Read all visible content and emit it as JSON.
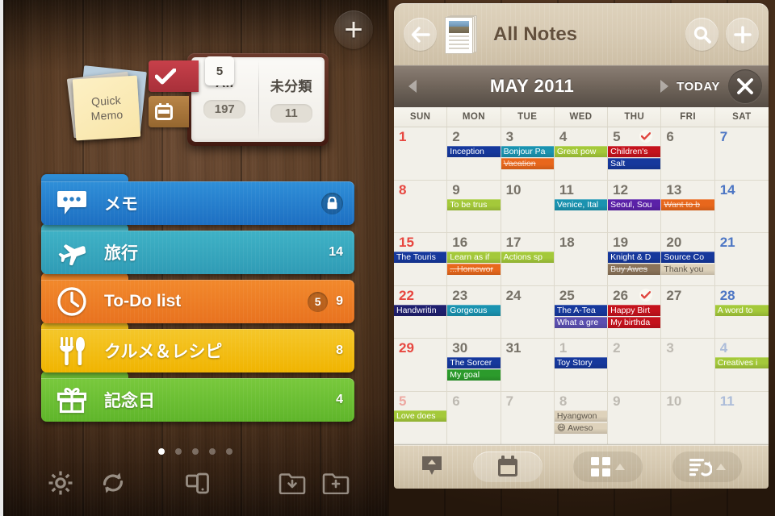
{
  "left": {
    "add_button_icon": "plus-icon",
    "quick_memo": {
      "line1": "Quick",
      "line2": "Memo"
    },
    "notebook": {
      "check_tab_icon": "check-icon",
      "calendar_tab_icon": "calendar-icon",
      "check_badge": "5",
      "pages": [
        {
          "title": "All",
          "count": "197"
        },
        {
          "title": "未分類",
          "count": "11"
        }
      ]
    },
    "folders": [
      {
        "name": "メモ",
        "icon": "speech-bubble-icon",
        "count": "",
        "badge": "",
        "locked": true,
        "color": "#1d6fc2",
        "color2": "#2f8fd8",
        "tab": "#2a86cf"
      },
      {
        "name": "旅行",
        "icon": "airplane-icon",
        "count": "14",
        "badge": "",
        "locked": false,
        "color": "#2f9bb5",
        "color2": "#3fb2c6",
        "tab": "#44b0c2"
      },
      {
        "name": "To-Do list",
        "icon": "clock-icon",
        "count": "9",
        "badge": "5",
        "locked": false,
        "color": "#e8721f",
        "color2": "#f2892c",
        "tab": "#ef8526"
      },
      {
        "name": "クルメ＆レシピ",
        "icon": "cutlery-icon",
        "count": "8",
        "badge": "",
        "locked": false,
        "color": "#f0b400",
        "color2": "#f5c72b",
        "tab": "#f2bc0c"
      },
      {
        "name": "記念日",
        "icon": "gift-icon",
        "count": "4",
        "badge": "",
        "locked": false,
        "color": "#5fb52a",
        "color2": "#79c93d",
        "tab": "#6cc033"
      }
    ],
    "page_dots": {
      "count": 5,
      "active_index": 0
    },
    "toolbar": [
      {
        "icon": "gear-icon",
        "label": "Settings"
      },
      {
        "icon": "sync-icon",
        "label": "Sync"
      },
      {
        "icon": "devices-icon",
        "label": "Devices"
      },
      {
        "icon": "folder-down-icon",
        "label": "Import to folder"
      },
      {
        "icon": "folder-plus-icon",
        "label": "New folder"
      }
    ]
  },
  "right": {
    "header": {
      "back_icon": "back-arrow-icon",
      "thumb_icon": "note-thumbnail-icon",
      "title": "All Notes",
      "search_icon": "search-icon",
      "add_icon": "plus-icon"
    },
    "month_bar": {
      "prev_icon": "triangle-left-icon",
      "month_label": "MAY 2011",
      "next_icon": "triangle-right-icon",
      "today_label": "TODAY",
      "close_icon": "close-icon"
    },
    "calendar": {
      "day_headers": [
        "SUN",
        "MON",
        "TUE",
        "WED",
        "THU",
        "FRI",
        "SAT"
      ],
      "weeks": [
        [
          {
            "day": "1",
            "kind": "sun",
            "events": []
          },
          {
            "day": "2",
            "kind": "day",
            "events": [
              {
                "text": "Inception",
                "color": "#16389c"
              }
            ]
          },
          {
            "day": "3",
            "kind": "day",
            "events": [
              {
                "text": "Bonjour Pa",
                "color": "#1b93b0"
              },
              {
                "text": "Vacation",
                "color": "#e8671c",
                "done": true
              }
            ]
          },
          {
            "day": "4",
            "kind": "day",
            "events": [
              {
                "text": "Great pow",
                "color": "#a4c93a"
              }
            ]
          },
          {
            "day": "5",
            "kind": "day",
            "checked": true,
            "events": [
              {
                "text": "Children's",
                "color": "#c4121c"
              },
              {
                "text": "Salt",
                "color": "#16389c"
              }
            ]
          },
          {
            "day": "6",
            "kind": "day",
            "events": []
          },
          {
            "day": "7",
            "kind": "sat",
            "events": []
          }
        ],
        [
          {
            "day": "8",
            "kind": "sun",
            "events": []
          },
          {
            "day": "9",
            "kind": "day",
            "events": [
              {
                "text": "To be trus",
                "color": "#a4c93a"
              }
            ]
          },
          {
            "day": "10",
            "kind": "day",
            "events": []
          },
          {
            "day": "11",
            "kind": "day",
            "events": [
              {
                "text": "Venice, Ital",
                "color": "#1b93b0"
              }
            ]
          },
          {
            "day": "12",
            "kind": "day",
            "events": [
              {
                "text": "Seoul, Sou",
                "color": "#5b21a8"
              }
            ]
          },
          {
            "day": "13",
            "kind": "day",
            "events": [
              {
                "text": "Want to b",
                "color": "#e8671c",
                "done": true
              }
            ]
          },
          {
            "day": "14",
            "kind": "sat",
            "events": []
          }
        ],
        [
          {
            "day": "15",
            "kind": "sun",
            "events": [
              {
                "text": "The Touris",
                "color": "#16389c"
              }
            ]
          },
          {
            "day": "16",
            "kind": "day",
            "events": [
              {
                "text": "Learn as if",
                "color": "#a4c93a"
              },
              {
                "text": "...Homewor",
                "color": "#e8671c",
                "done": true
              }
            ]
          },
          {
            "day": "17",
            "kind": "day",
            "events": [
              {
                "text": "Actions sp",
                "color": "#a4c93a"
              }
            ]
          },
          {
            "day": "18",
            "kind": "day",
            "events": []
          },
          {
            "day": "19",
            "kind": "day",
            "events": [
              {
                "text": "Knight & D",
                "color": "#16389c"
              },
              {
                "text": "Buy Awes",
                "color": "#8a7359",
                "done": true
              }
            ]
          },
          {
            "day": "20",
            "kind": "day",
            "events": [
              {
                "text": "Source Co",
                "color": "#16389c"
              },
              {
                "text": "Thank you",
                "color": "#ded2bb",
                "dark": true
              }
            ]
          },
          {
            "day": "21",
            "kind": "sat",
            "events": []
          }
        ],
        [
          {
            "day": "22",
            "kind": "sun",
            "events": [
              {
                "text": "Handwritin",
                "color": "#1f1f6e"
              }
            ]
          },
          {
            "day": "23",
            "kind": "day",
            "events": [
              {
                "text": "Gorgeous",
                "color": "#1b93b0"
              }
            ]
          },
          {
            "day": "24",
            "kind": "day",
            "events": []
          },
          {
            "day": "25",
            "kind": "day",
            "events": [
              {
                "text": "The A-Tea",
                "color": "#16389c"
              },
              {
                "text": "What a gre",
                "color": "#5b4fb0"
              }
            ]
          },
          {
            "day": "26",
            "kind": "day",
            "checked": true,
            "events": [
              {
                "text": "Happy Birt",
                "color": "#c4121c"
              },
              {
                "text": "My birthda",
                "color": "#c4121c"
              }
            ]
          },
          {
            "day": "27",
            "kind": "day",
            "events": []
          },
          {
            "day": "28",
            "kind": "sat",
            "events": [
              {
                "text": "A word to",
                "color": "#a4c93a"
              }
            ]
          }
        ],
        [
          {
            "day": "29",
            "kind": "sun",
            "events": []
          },
          {
            "day": "30",
            "kind": "day",
            "events": [
              {
                "text": "The Sorcer",
                "color": "#16389c"
              },
              {
                "text": "My goal",
                "color": "#2c9b2c"
              }
            ]
          },
          {
            "day": "31",
            "kind": "day",
            "events": []
          },
          {
            "day": "1",
            "kind": "out",
            "events": [
              {
                "text": "Toy Story",
                "color": "#16389c"
              }
            ]
          },
          {
            "day": "2",
            "kind": "out",
            "events": []
          },
          {
            "day": "3",
            "kind": "out",
            "events": []
          },
          {
            "day": "4",
            "kind": "out-sat",
            "events": [
              {
                "text": "Creatives i",
                "color": "#a4c93a"
              }
            ]
          }
        ],
        [
          {
            "day": "5",
            "kind": "out-sun",
            "events": [
              {
                "text": "Love does",
                "color": "#a4c93a"
              }
            ]
          },
          {
            "day": "6",
            "kind": "out",
            "events": []
          },
          {
            "day": "7",
            "kind": "out",
            "events": []
          },
          {
            "day": "8",
            "kind": "out",
            "events": [
              {
                "text": "Hyangwon",
                "color": "#ded2bb",
                "dark": true
              },
              {
                "text": "😄 Aweso",
                "color": "#ded2bb",
                "dark": true
              }
            ]
          },
          {
            "day": "9",
            "kind": "out",
            "events": []
          },
          {
            "day": "10",
            "kind": "out",
            "events": []
          },
          {
            "day": "11",
            "kind": "out-sat",
            "events": []
          }
        ]
      ]
    },
    "toolbar": [
      {
        "icon": "export-icon",
        "label": "Export",
        "style": "plain"
      },
      {
        "icon": "calendar-icon",
        "label": "Calendar",
        "style": "pill"
      },
      {
        "icon": "grid-view-icon",
        "label": "Grid",
        "style": "dim",
        "caret": true
      },
      {
        "icon": "sort-list-icon",
        "label": "Sort",
        "style": "dim",
        "caret": true
      }
    ]
  },
  "colors": {
    "accent_red": "#c4121c",
    "accent_blue": "#16389c",
    "wood": "#54371f",
    "paper": "#f2f0e9"
  }
}
